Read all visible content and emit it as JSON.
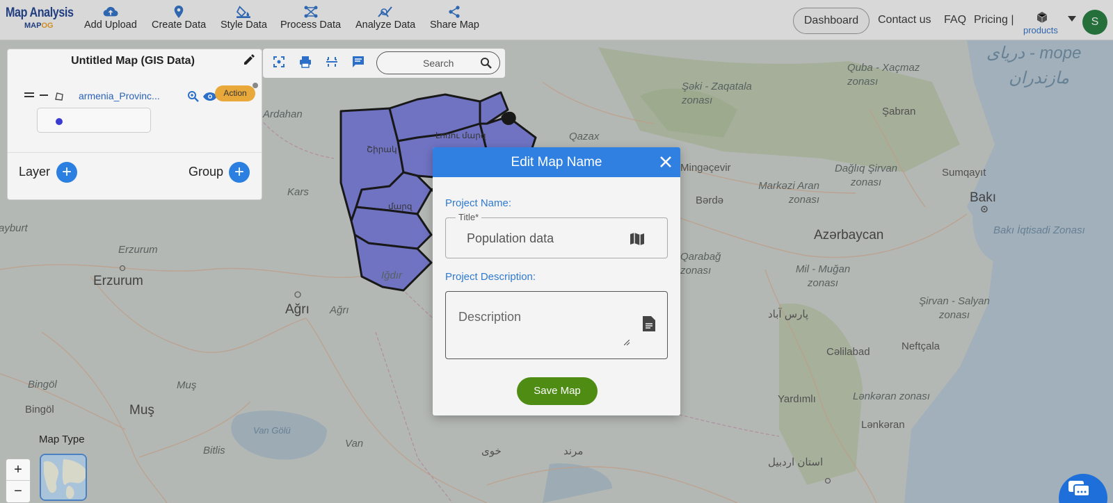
{
  "app": {
    "logo_line1": "Map Analysis",
    "logo_line2_a": "MAP",
    "logo_line2_b": "OG"
  },
  "nav": {
    "items": [
      {
        "label": "Add Upload",
        "icon": "cloud-upload-icon"
      },
      {
        "label": "Create Data",
        "icon": "location-pin-icon"
      },
      {
        "label": "Style Data",
        "icon": "paint-bucket-icon"
      },
      {
        "label": "Process Data",
        "icon": "process-nodes-icon"
      },
      {
        "label": "Analyze Data",
        "icon": "analyze-chart-icon"
      },
      {
        "label": "Share Map",
        "icon": "share-icon"
      }
    ],
    "dashboard": "Dashboard",
    "contact": "Contact us",
    "faq": "FAQ",
    "pricing": "Pricing |",
    "products": "products",
    "avatar_letter": "S"
  },
  "panel": {
    "title": "Untitled Map (GIS Data)",
    "layer_name": "armenia_Provinc...",
    "action": "Action",
    "layer_label": "Layer",
    "group_label": "Group"
  },
  "toolbar": {
    "search_placeholder": "Search"
  },
  "modal": {
    "title": "Edit Map Name",
    "project_name_label": "Project Name:",
    "title_legend": "Title*",
    "title_value": "Population data",
    "project_description_label": "Project Description:",
    "description_placeholder": "Description",
    "save_label": "Save Map"
  },
  "map": {
    "map_type_label": "Map Type",
    "zoom_in": "+",
    "zoom_out": "−",
    "labels": [
      "Ardahan",
      "Kars",
      "Erzurum",
      "Erzurum",
      "Ağrı",
      "Ağrı",
      "Iğdır",
      "Bingöl",
      "Bingöl",
      "Muş",
      "Muş",
      "Van Gölü",
      "Van",
      "Bitlis",
      "ayburt",
      "Qazax",
      "Şəki - Zaqatala zonası",
      "Quba - Xaçmaz zonası",
      "Şabran",
      "Mingəçevir",
      "Dağlıq Şirvan zonası",
      "Markəzi Aran zonası",
      "Bərdə",
      "Sumqayıt",
      "Bakı",
      "Bakı İqtisadi Zonası",
      "Azərbaycan",
      "Qarabağ zonası",
      "Mil - Muğan zonası",
      "Şirvan - Salyan zonası",
      "پارس آباد",
      "Cəlilabad",
      "Neftçala",
      "Yardımlı",
      "Lənkəran zonası",
      "Lənkəran",
      "خوی",
      "مرند",
      "استان اردبیل",
      "دریای - mope",
      "مازندران",
      "Լոռու մարզ",
      "Շիրակ",
      "մարզ"
    ]
  }
}
